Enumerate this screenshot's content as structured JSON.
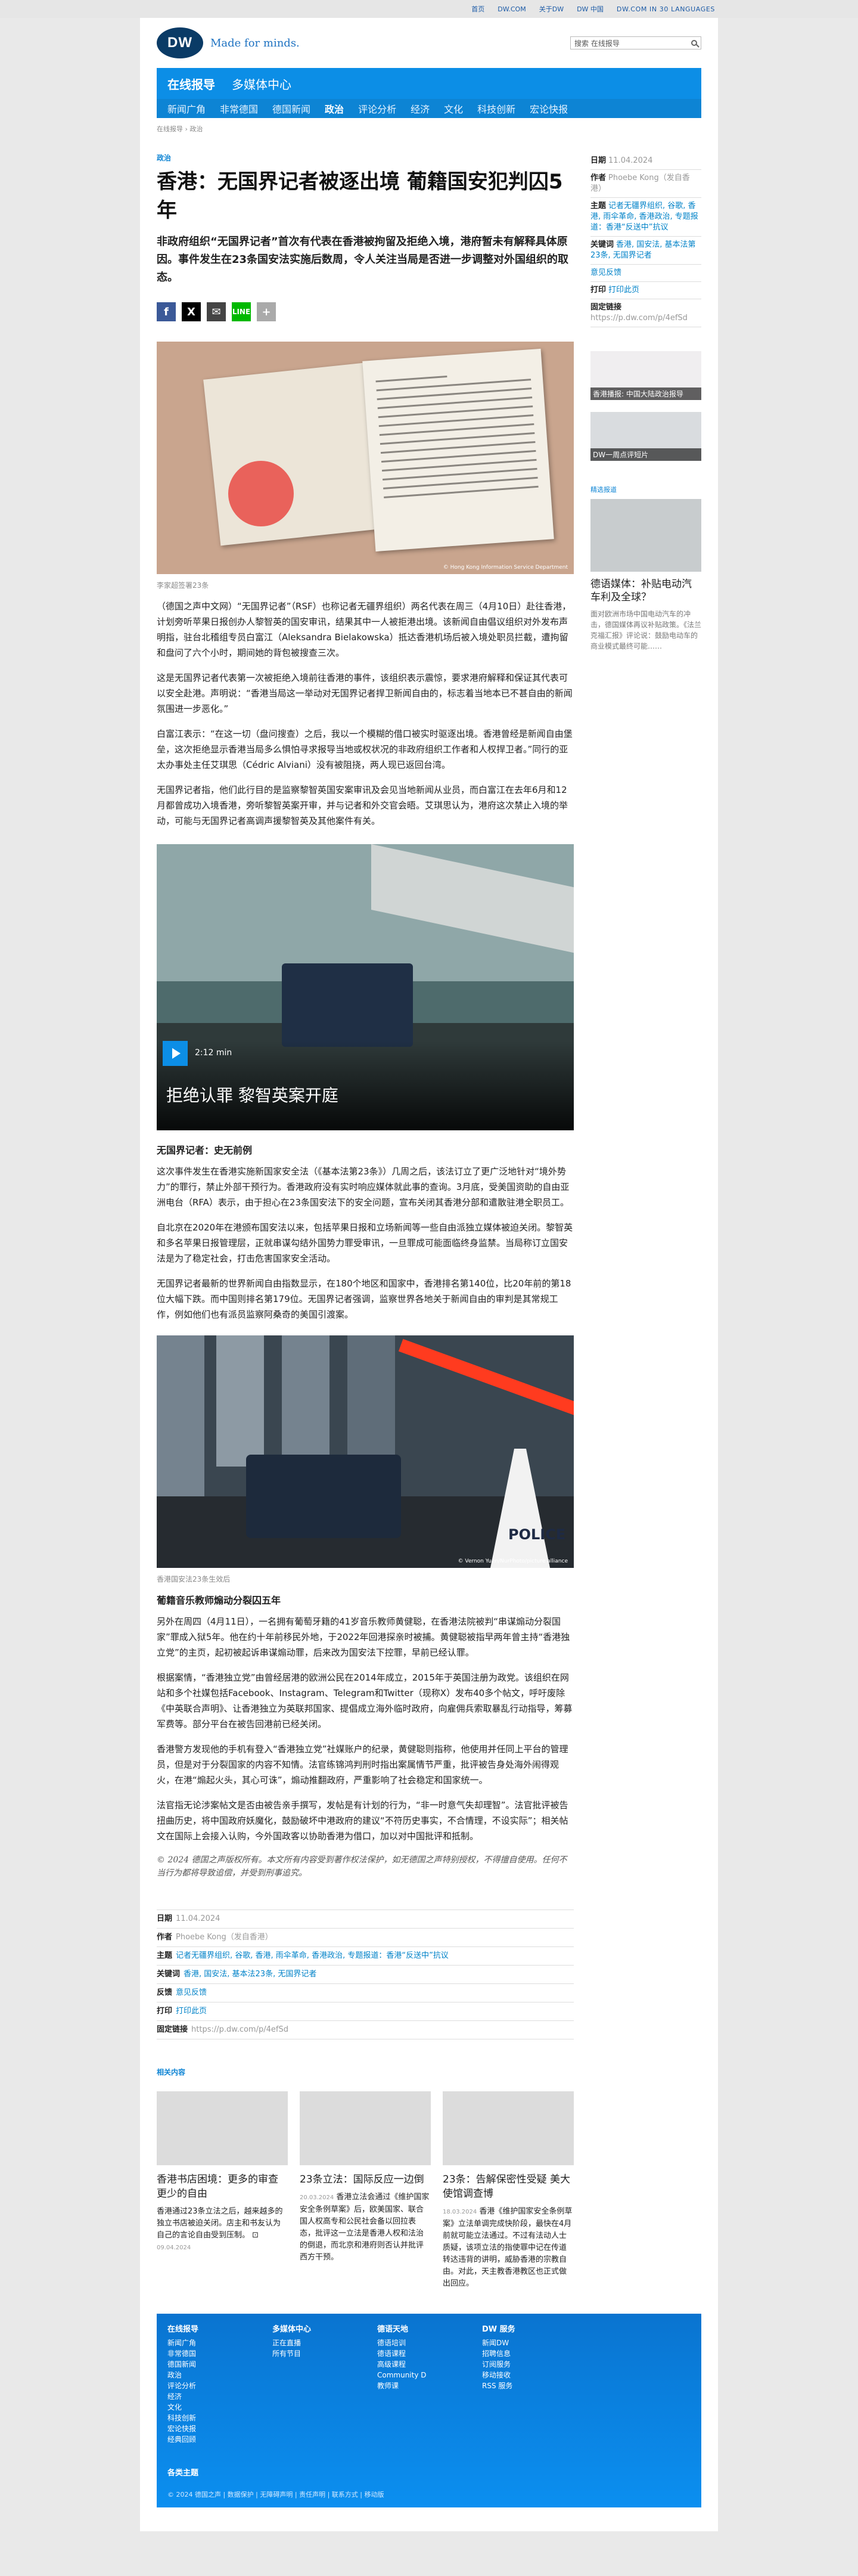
{
  "topbar": {
    "links": [
      "首页",
      "DW.COM",
      "关于DW",
      "DW 中国",
      "DW.COM IN 30 LANGUAGES"
    ]
  },
  "header": {
    "logo": "DW",
    "tagline": "Made for minds.",
    "search_placeholder": "搜索 在线报导"
  },
  "nav": {
    "top": [
      "在线报导",
      "多媒体中心"
    ],
    "bottom": [
      "新闻广角",
      "非常德国",
      "德国新闻",
      "政治",
      "评论分析",
      "经济",
      "文化",
      "科技创新",
      "宏论快报"
    ]
  },
  "breadcrumb": "在线报导 › 政治",
  "article": {
    "kicker": "政治",
    "title": "香港：无国界记者被逐出境 葡籍国安犯判囚5年",
    "lead": "非政府组织“无国界记者”首次有代表在香港被拘留及拒绝入境，港府暂未有解释具体原因。事件发生在23条国安法实施后数周，令人关注当局是否进一步调整对外国组织的取态。",
    "share": [
      "f",
      "X",
      "✉",
      "LINE",
      "+"
    ],
    "photo1_credit": "© Hong Kong Information Service Department",
    "photo1_caption": "李家超签署23条",
    "p1": "（德国之声中文网）“无国界记者”（RSF）也称记者无疆界组织）两名代表在周三（4月10日）赴往香港，计划旁听苹果日报创办人黎智英的国安审讯，结果其中一人被拒港出境。该新闻自由倡议组织对外发布声明指，驻台北稽组专员白富江（Aleksandra Bielakowska）抵达香港机场后被入境处职员拦截，遭拘留和盘问了六个小时，期间她的背包被搜查三次。",
    "p2": "这是无国界记者代表第一次被拒绝入境前往香港的事件，该组织表示震惊，要求港府解释和保证其代表可以安全赴港。声明说：“香港当局这一举动对无国界记者捍卫新闻自由的，标志着当地本已不甚自由的新闻氛围进一步恶化。”",
    "p3": "白富江表示：“在这一切（盘问搜查）之后，我以一个模糊的借口被实时驱逐出境。香港曾经是新闻自由堡垒，这次拒绝显示香港当局多么惧怕寻求报导当地或权状况的非政府组织工作者和人权捍卫者。”同行的亚太办事处主任艾琪思（Cédric Alviani）没有被阻挠，两人现已返回台湾。",
    "p4": "无国界记者指，他们此行目的是监察黎智英国安案审讯及会见当地新闻从业员，而白富江在去年6月和12月都曾成功入境香港，旁听黎智英案开审，并与记者和外交官会晤。艾琪思认为，港府这次禁止入境的举动，可能与无国界记者高调声援黎智英及其他案件有关。",
    "video_duration": "2:12 min",
    "video_title": "拒绝认罪 黎智英案开庭",
    "h_a": "无国界记者：史无前例",
    "p5": "这次事件发生在香港实施新国家安全法（《基本法第23条》）几周之后，该法订立了更广泛地针对“境外势力”的罪行，禁止外部干预行为。香港政府没有实时响应媒体就此事的查询。3月底，受美国资助的自由亚洲电台（RFA）表示，由于担心在23条国安法下的安全问题，宣布关闭其香港分部和遣散驻港全职员工。",
    "p6": "自北京在2020年在港颁布国安法以来，包括苹果日报和立场新闻等一些自由派独立媒体被迫关闭。黎智英和多名苹果日报管理层，正就串谋勾结外国势力罪受审讯，一旦罪成可能面临终身监禁。当局称订立国安法是为了稳定社会，打击危害国家安全活动。",
    "p7": "无国界记者最新的世界新闻自由指数显示，在180个地区和国家中，香港排名第140位，比20年前的第18位大幅下跌。而中国则排名第179位。无国界记者强调，监察世界各地关于新闻自由的审判是其常规工作，例如他们也有派员监察阿桑奇的美国引渡案。",
    "photo2_credit": "© Vernon Yuen/NurPhoto/picture alliance",
    "photo2_caption": "香港国安法23条生效后",
    "h_b": "葡籍音乐教师煽动分裂囚五年",
    "p8": "另外在周四（4月11日），一名拥有葡萄牙籍的41岁音乐教师黄健聪，在香港法院被判“串谋煽动分裂国家”罪成入狱5年。他在约十年前移民外地，于2022年回港探亲时被捕。黄健聪被指早两年曾主持“香港独立党”的主页，起初被起诉串谋煽动罪，后来改为国安法下控罪，早前已经认罪。",
    "p9": "根据案情，“香港独立党”由曾经居港的欧洲公民在2014年成立，2015年于英国注册为政党。该组织在网站和多个社媒包括Facebook、Instagram、Telegram和Twitter（现称X）发布40多个帖文，呼吁废除《中英联合声明》、让香港独立为英联邦国家、提倡成立海外临时政府，向雇佣兵索取暴乱行动指导，筹募军费等。部分平台在被告回港前已经关闭。",
    "p10": "香港警方发现他的手机有登入“香港独立党”社媒账户的纪录，黄健聪则指称，他使用并任同上平台的管理员，但是对于分裂国家的内容不知情。法官练锦鸿判刑时指出案属情节严重，批评被告身处海外闹得观火，在港“煽起火头，其心可诛”，煽动推翻政府，严重影响了社会稳定和国家统一。",
    "p11": "法官指无论涉案帖文是否由被告亲手撰写，发帖是有计划的行为，“非一时意气失却理智”。法官批评被告扭曲历史，将中国政府妖魔化，鼓励破坏中港政府的建议“不符历史事实，不合情理，不设实际”；相关帖文在国际上会接入认购，今外国政客以协助香港为借口，加以对中国批评和抵制。",
    "copyright": "© 2024 德国之声版权所有。本文所有内容受到著作权法保护，如无德国之声特别授权，不得擅自使用。任何不当行为都将导致追偿，并受到刑事追究。"
  },
  "meta": {
    "date_label": "日期",
    "date": "11.04.2024",
    "author_label": "作者",
    "author": "Phoebe Kong（发自香港）",
    "topics_label": "主题",
    "topics": "记者无疆界组织, 谷歌, 香港, 雨伞革命, 香港政治, 专题报道：香港“反送中”抗议",
    "keywords_label": "关键词",
    "keywords": "香港, 国安法, 基本法23条, 无国界记者",
    "feedback_label": "反馈",
    "feedback": "意见反馈",
    "print_label": "打印",
    "print": "打印此页",
    "link_label": "固定链接",
    "link": "https://p.dw.com/p/4efSd"
  },
  "related": {
    "heading": "相关内容",
    "cards": [
      {
        "title": "香港书店困境：更多的审查 更少的自由",
        "date": "09.04.2024",
        "text": "香港通过23条立法之后，越来越多的独立书店被迫关闭。店主和书友认为自己的言论自由受到压制。 ⊡"
      },
      {
        "title": "23条立法：国际反应一边倒",
        "date": "20.03.2024",
        "text": "香港立法会通过《维护国家安全条例草案》后，欧美国家、联合国人权高专和公民社会备以回拉表态，批评这一立法是香港人权和法治的倒退，而北京和港府则否认并批评西方干预。"
      },
      {
        "title": "23条：告解保密性受疑 美大使馆调查博",
        "date": "18.03.2024",
        "text": "香港《维护国家安全条例草案》立法单调完成快阶段，最快在4月前就可能立法通过。不过有法动人士质疑，该项立法的指使罪中记在传道转达违背的讲明，威胁香港的宗教自由。对此，天主教香港教区也正式做出回应。"
      }
    ]
  },
  "sidebar": {
    "date_label": "日期",
    "date": "11.04.2024",
    "author_label": "作者",
    "author": "Phoebe Kong（发自香港）",
    "topics_label": "主题",
    "topics": "记者无疆界组织, 谷歌, 香港, 雨伞革命, 香港政治, 专题报道：香港“反送中”抗议",
    "keywords_label": "关键词",
    "keywords": "香港, 国安法, 基本法第23条, 无国界记者",
    "feedback": "意见反馈",
    "print_label": "打印",
    "print": "打印此页",
    "link_label": "固定链接",
    "link": "https://p.dw.com/p/4efSd",
    "img1_caption": "香港播报: 中国大陆政治报导",
    "img2_caption": "DW一周点评短片",
    "section_heading": "精选报道",
    "feature_title": "德语媒体：补贴电动汽车利及全球？",
    "feature_text": "面对欧洲市场中国电动汽车的冲击，德国媒体再议补贴政策。《法兰克福汇报》评论说：鼓励电动车的商业模式最终可能……"
  },
  "footer": {
    "cols": [
      {
        "title": "在线报导",
        "items": [
          "新闻广角",
          "非常德国",
          "德国新闻",
          "政治",
          "评论分析",
          "经济",
          "文化",
          "科技创新",
          "宏论快报",
          "经典回顾"
        ]
      },
      {
        "title": "多媒体中心",
        "items": [
          "正在直播",
          "所有节目"
        ]
      },
      {
        "title": "德语天地",
        "items": [
          "德语培训",
          "德语课程",
          "高级课程",
          "Community D",
          "教师课"
        ]
      },
      {
        "title": "DW 服务",
        "items": [
          "新闻DW",
          "招聘信息",
          "订阅服务",
          "移动接收",
          "RSS 服务"
        ]
      }
    ],
    "more": "各类主题",
    "legal": "© 2024 德国之声 | 数据保护 | 无障碍声明 | 责任声明 | 联系方式 | 移动版"
  }
}
